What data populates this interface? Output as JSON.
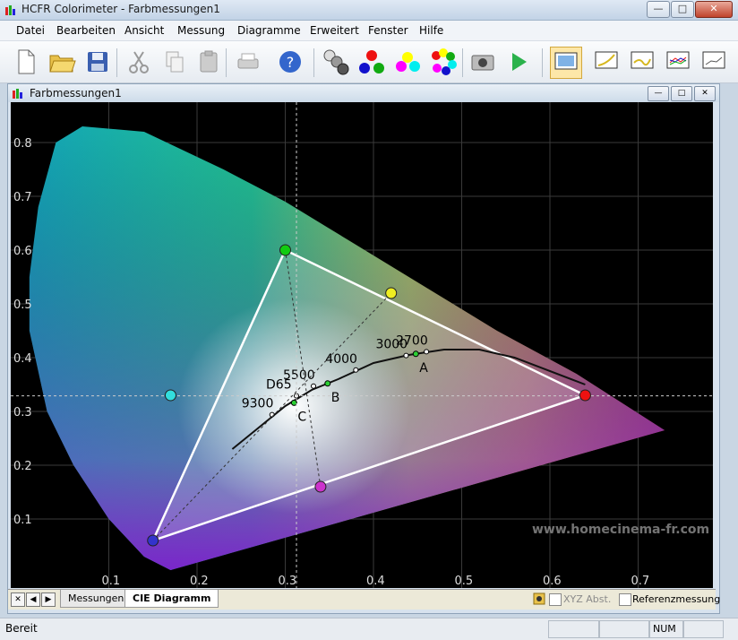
{
  "window": {
    "title": "HCFR Colorimeter - Farbmessungen1"
  },
  "menu": [
    "Datei",
    "Bearbeiten",
    "Ansicht",
    "Messung",
    "Diagramme",
    "Erweitert",
    "Fenster",
    "Hilfe"
  ],
  "toolbar": {
    "icons": [
      "new-document-icon",
      "open-folder-icon",
      "save-icon",
      "cut-icon",
      "copy-icon",
      "paste-icon",
      "print-icon",
      "help-icon",
      "gray-scale-icon",
      "primaries-icon",
      "secondaries-icon",
      "all-colors-icon",
      "camera-icon",
      "play-icon",
      "monitor-icon",
      "chart-gamma-icon",
      "chart-luminance-icon",
      "chart-rgb-icon",
      "chart-deltae-icon"
    ]
  },
  "document": {
    "title": "Farbmessungen1"
  },
  "tabs": {
    "items": [
      "Messungen",
      "CIE Diagramm"
    ]
  },
  "options": {
    "xyz_label": "XYZ Abst.",
    "reference_label": "Referenzmessung"
  },
  "status": {
    "text": "Bereit",
    "num": "NUM"
  },
  "watermark": "www.homecinema-fr.com",
  "colors": {
    "background": "#000000",
    "grid": "#3a3a3a",
    "gamut": "#ffffff",
    "locus": "#111111"
  },
  "chart_data": {
    "type": "scatter",
    "x_ticks": [
      0.1,
      0.2,
      0.3,
      0.4,
      0.5,
      0.6,
      0.7
    ],
    "y_ticks": [
      0.1,
      0.2,
      0.3,
      0.4,
      0.5,
      0.6,
      0.7,
      0.8
    ],
    "xlim": [
      0.0,
      0.8
    ],
    "ylim": [
      0.0,
      0.9
    ],
    "grid": true,
    "primaries": [
      {
        "name": "red",
        "x": 0.64,
        "y": 0.33,
        "color": "#e11"
      },
      {
        "name": "green",
        "x": 0.3,
        "y": 0.6,
        "color": "#1c1"
      },
      {
        "name": "blue",
        "x": 0.15,
        "y": 0.06,
        "color": "#33c"
      }
    ],
    "secondaries": [
      {
        "name": "yellow",
        "x": 0.42,
        "y": 0.52,
        "color": "#ee2"
      },
      {
        "name": "cyan",
        "x": 0.17,
        "y": 0.33,
        "color": "#3dd"
      },
      {
        "name": "magenta",
        "x": 0.34,
        "y": 0.16,
        "color": "#c3c"
      }
    ],
    "temperature_labels": [
      {
        "label": "9300",
        "x": 0.285,
        "y": 0.294
      },
      {
        "label": "D65",
        "x": 0.3127,
        "y": 0.329
      },
      {
        "label": "5500",
        "x": 0.332,
        "y": 0.347
      },
      {
        "label": "4000",
        "x": 0.38,
        "y": 0.377
      },
      {
        "label": "3000",
        "x": 0.437,
        "y": 0.404
      },
      {
        "label": "2700",
        "x": 0.46,
        "y": 0.411
      }
    ],
    "illuminants": [
      {
        "label": "A",
        "x": 0.448,
        "y": 0.407
      },
      {
        "label": "B",
        "x": 0.348,
        "y": 0.352
      },
      {
        "label": "C",
        "x": 0.31,
        "y": 0.316
      }
    ],
    "planckian_locus": [
      [
        0.24,
        0.23
      ],
      [
        0.27,
        0.27
      ],
      [
        0.3,
        0.31
      ],
      [
        0.33,
        0.34
      ],
      [
        0.36,
        0.36
      ],
      [
        0.4,
        0.39
      ],
      [
        0.44,
        0.405
      ],
      [
        0.48,
        0.415
      ],
      [
        0.52,
        0.415
      ],
      [
        0.56,
        0.4
      ],
      [
        0.64,
        0.35
      ]
    ],
    "spectral_locus": [
      [
        0.17,
        0.005
      ],
      [
        0.14,
        0.03
      ],
      [
        0.1,
        0.1
      ],
      [
        0.06,
        0.2
      ],
      [
        0.03,
        0.3
      ],
      [
        0.01,
        0.45
      ],
      [
        0.01,
        0.55
      ],
      [
        0.02,
        0.68
      ],
      [
        0.04,
        0.8
      ],
      [
        0.07,
        0.83
      ],
      [
        0.14,
        0.82
      ],
      [
        0.23,
        0.75
      ],
      [
        0.3,
        0.69
      ],
      [
        0.37,
        0.62
      ],
      [
        0.45,
        0.54
      ],
      [
        0.54,
        0.45
      ],
      [
        0.63,
        0.37
      ],
      [
        0.73,
        0.265
      ]
    ]
  }
}
